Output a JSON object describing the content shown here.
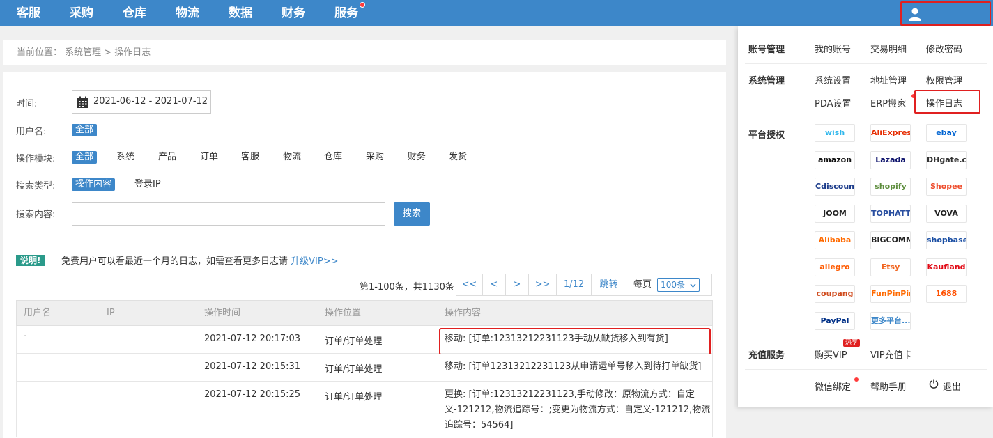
{
  "topnav": {
    "items": [
      "客服",
      "采购",
      "仓库",
      "物流",
      "数据",
      "财务",
      "服务"
    ],
    "colors": {
      "bar": "#3d87c9",
      "highlight": "#e02020"
    }
  },
  "breadcrumb": {
    "text": "当前位置： 系统管理 > 操作日志"
  },
  "filters": {
    "time_label": "时间:",
    "date_range": "2021-06-12 - 2021-07-12",
    "username_label": "用户名:",
    "username_options": [
      "全部"
    ],
    "module_label": "操作模块:",
    "module_options": [
      "全部",
      "系统",
      "产品",
      "订单",
      "客服",
      "物流",
      "仓库",
      "采购",
      "财务",
      "发货"
    ],
    "search_type_label": "搜索类型:",
    "search_type_options": [
      "操作内容",
      "登录IP"
    ],
    "search_content_label": "搜索内容:",
    "search_placeholder": "",
    "search_button": "搜索"
  },
  "notice": {
    "badge": "说明!",
    "text": "免费用户可以看最近一个月的日志，如需查看更多日志请",
    "link": "升级VIP>>"
  },
  "pager": {
    "info": "第1-100条，共1130条",
    "first": "<<",
    "prev": "<",
    "next": ">",
    "last": ">>",
    "page": "1/12",
    "jump": "跳转",
    "per_page_label": "每页",
    "per_page_value": "100条"
  },
  "table": {
    "headers": [
      "用户名",
      "IP",
      "操作时间",
      "操作位置",
      "操作内容"
    ],
    "rows": [
      {
        "user": "·",
        "ip": "",
        "time": "2021-07-12 20:17:03",
        "location": "订单/订单处理",
        "content": "移动: [订单:12313212231123手动从缺货移入到有货]"
      },
      {
        "user": "",
        "ip": "",
        "time": "2021-07-12 20:15:31",
        "location": "订单/订单处理",
        "content": "移动: [订单12313212231123从申请运单号移入到待打单缺货]"
      },
      {
        "user": "",
        "ip": "",
        "time": "2021-07-12 20:15:25",
        "location": "订单/订单处理",
        "content": "更换: [订单:12313212231123,手动修改：原物流方式：自定义-121212,物流追踪号：;变更为物流方式：自定义-121212,物流追踪号：54564]"
      }
    ]
  },
  "menu": {
    "account_title": "账号管理",
    "account_links": [
      "我的账号",
      "交易明细",
      "修改密码"
    ],
    "system_title": "系统管理",
    "system_links": [
      "系统设置",
      "地址管理",
      "权限管理",
      "PDA设置",
      "ERP搬家",
      "操作日志"
    ],
    "platform_title": "平台授权",
    "platforms": [
      {
        "name": "wish",
        "color": "#2fb7ec"
      },
      {
        "name": "AliExpress",
        "color": "#e62e04"
      },
      {
        "name": "ebay",
        "color": "#0064d2"
      },
      {
        "name": "amazon",
        "color": "#111111"
      },
      {
        "name": "Lazada",
        "color": "#0f146d"
      },
      {
        "name": "DHgate.com",
        "color": "#333333"
      },
      {
        "name": "Cdiscount",
        "color": "#1b3b8a"
      },
      {
        "name": "shopify",
        "color": "#5e8e3e"
      },
      {
        "name": "Shopee",
        "color": "#ee4d2d"
      },
      {
        "name": "JOOM",
        "color": "#222222"
      },
      {
        "name": "TOPHATTER",
        "color": "#2a4fa0"
      },
      {
        "name": "VOVA",
        "color": "#222222"
      },
      {
        "name": "Alibaba",
        "color": "#ff6a00"
      },
      {
        "name": "BIGCOMMERCE",
        "color": "#222222"
      },
      {
        "name": "shopbase",
        "color": "#1a4ea3"
      },
      {
        "name": "allegro",
        "color": "#ff5a00"
      },
      {
        "name": "Etsy",
        "color": "#f1641e"
      },
      {
        "name": "Kaufland",
        "color": "#e10915"
      },
      {
        "name": "coupang",
        "color": "#d04c1e"
      },
      {
        "name": "FunPinPin",
        "color": "#ff6a00"
      },
      {
        "name": "1688",
        "color": "#ff5000"
      },
      {
        "name": "PayPal",
        "color": "#003087"
      },
      {
        "name": "更多平台...",
        "color": "#3d87c9"
      }
    ],
    "recharge_title": "充值服务",
    "buy_vip": "购买VIP",
    "hot_badge": "热享",
    "vip_card": "VIP充值卡",
    "wechat_bind": "微信绑定",
    "help": "帮助手册",
    "logout": "退出"
  }
}
